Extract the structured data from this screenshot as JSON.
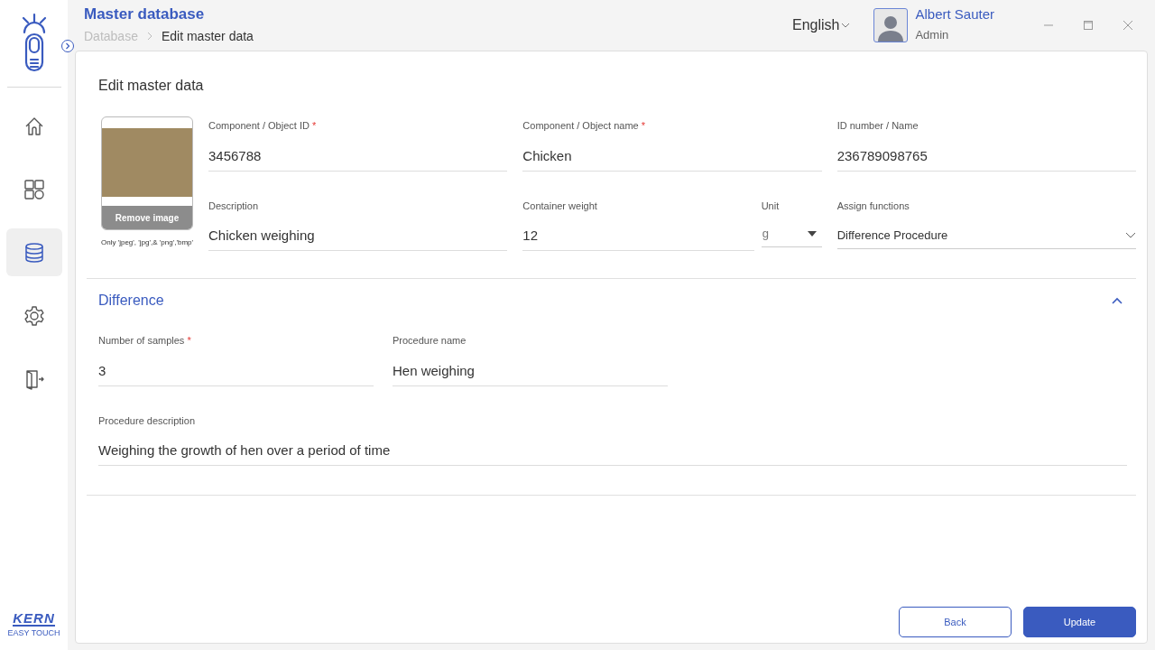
{
  "header": {
    "title": "Master database",
    "breadcrumb": [
      "Database",
      "Edit master data"
    ],
    "language": "English",
    "user": {
      "name": "Albert Sauter",
      "role": "Admin"
    }
  },
  "sidebar": {
    "items": [
      {
        "kind": "home",
        "selected": false
      },
      {
        "kind": "apps",
        "selected": false
      },
      {
        "kind": "database",
        "selected": true
      },
      {
        "kind": "settings",
        "selected": false
      },
      {
        "kind": "logout",
        "selected": false
      }
    ],
    "logo": {
      "brand": "KERN",
      "tagline": "EASY TOUCH"
    }
  },
  "form": {
    "title": "Edit master data",
    "image": {
      "button": "Remove image",
      "hint": "Only 'jpeg', 'jpg',& 'png','bmp'"
    },
    "fields": [
      {
        "label": "Component / Object ID",
        "required_mark": "*",
        "value": "3456788"
      },
      {
        "label": "Component / Object name",
        "required_mark": "*",
        "value": "Chicken"
      },
      {
        "label": "ID number / Name",
        "value": "236789098765"
      },
      {
        "label": "Description",
        "value": "Chicken weighing"
      },
      {
        "label": "Container weight",
        "value": "12"
      },
      {
        "label": "Unit",
        "value": "g",
        "kind": "select"
      },
      {
        "label": "Assign functions",
        "value": "Difference Procedure",
        "kind": "dropdown"
      }
    ]
  },
  "section": {
    "title": "Difference",
    "expanded": true,
    "fields": [
      {
        "label": "Number of samples",
        "required_mark": "*",
        "value": "3"
      },
      {
        "label": "Procedure name",
        "value": "Hen weighing"
      }
    ],
    "description": {
      "label": "Procedure description",
      "value": "Weighing the growth of hen over a period of time"
    }
  },
  "buttons": [
    {
      "label": "Back",
      "kind": "secondary"
    },
    {
      "label": "Update",
      "kind": "primary"
    }
  ]
}
